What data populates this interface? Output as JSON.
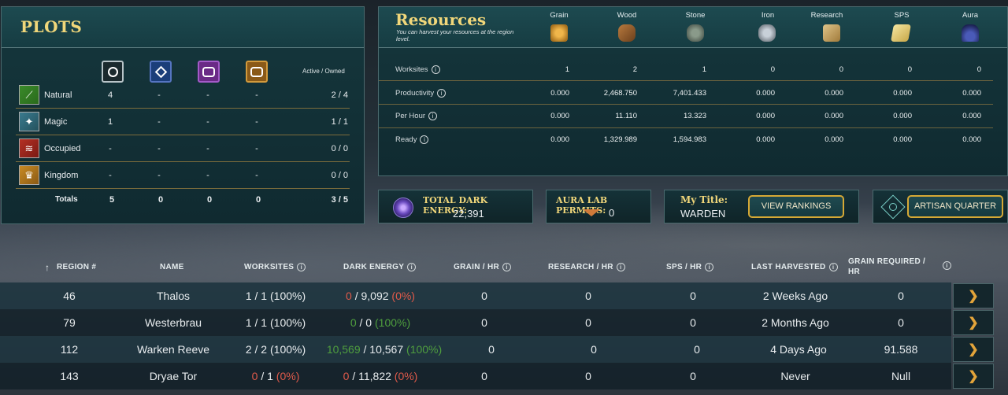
{
  "plots": {
    "title": "PLOTS",
    "active_owned_label": "Active / Owned",
    "rows": [
      {
        "label": "Natural",
        "c1": "4",
        "c2": "-",
        "c3": "-",
        "c4": "-",
        "ratio": "2 / 4"
      },
      {
        "label": "Magic",
        "c1": "1",
        "c2": "-",
        "c3": "-",
        "c4": "-",
        "ratio": "1 / 1"
      },
      {
        "label": "Occupied",
        "c1": "-",
        "c2": "-",
        "c3": "-",
        "c4": "-",
        "ratio": "0 / 0"
      },
      {
        "label": "Kingdom",
        "c1": "-",
        "c2": "-",
        "c3": "-",
        "c4": "-",
        "ratio": "0 / 0"
      }
    ],
    "totals": {
      "label": "Totals",
      "c1": "5",
      "c2": "0",
      "c3": "0",
      "c4": "0",
      "ratio": "3 / 5"
    }
  },
  "resources": {
    "title": "Resources",
    "subtitle": "You can harvest your resources at the region level.",
    "columns": [
      "Grain",
      "Wood",
      "Stone",
      "Iron",
      "Research",
      "SPS",
      "Aura"
    ],
    "rows": [
      {
        "label": "Worksites",
        "values": [
          "1",
          "2",
          "1",
          "0",
          "0",
          "0",
          "0"
        ]
      },
      {
        "label": "Productivity",
        "values": [
          "0.000",
          "2,468.750",
          "7,401.433",
          "0.000",
          "0.000",
          "0.000",
          "0.000"
        ]
      },
      {
        "label": "Per Hour",
        "values": [
          "0.000",
          "11.110",
          "13.323",
          "0.000",
          "0.000",
          "0.000",
          "0.000"
        ]
      },
      {
        "label": "Ready",
        "values": [
          "0.000",
          "1,329.989",
          "1,594.983",
          "0.000",
          "0.000",
          "0.000",
          "0.000"
        ]
      }
    ]
  },
  "status": {
    "dark_energy_label": "TOTAL DARK ENERGY:",
    "dark_energy_value": "22,391",
    "aura_label": "AURA LAB PERMITS:",
    "aura_value": "0",
    "title_label": "My Title:",
    "title_value": "WARDEN",
    "view_rankings": "VIEW RANKINGS",
    "artisan_quarter": "ARTISAN QUARTER"
  },
  "table": {
    "headers": {
      "sort_arrow": "↑",
      "region": "REGION #",
      "name": "NAME",
      "worksites": "WORKSITES",
      "dark_energy": "DARK ENERGY",
      "grain": "GRAIN / HR",
      "research": "RESEARCH / HR",
      "sps": "SPS / HR",
      "last_harvested": "LAST HARVESTED",
      "grain_required_1": "GRAIN REQUIRED /",
      "grain_required_2": "HR"
    },
    "rows": [
      {
        "region": "46",
        "name": "Thalos",
        "ws_a": "1",
        "ws_b": " / 1 ",
        "ws_pct": "(100%)",
        "de_a": "0",
        "de_b": " / 9,092 ",
        "de_pct": "(0%)",
        "grain": "0",
        "research": "0",
        "sps": "0",
        "last": "2 Weeks Ago",
        "req": "0"
      },
      {
        "region": "79",
        "name": "Westerbrau",
        "ws_a": "1",
        "ws_b": " / 1 ",
        "ws_pct": "(100%)",
        "de_a": "0",
        "de_b": " / 0 ",
        "de_pct": "(100%)",
        "grain": "0",
        "research": "0",
        "sps": "0",
        "last": "2 Months Ago",
        "req": "0"
      },
      {
        "region": "112",
        "name": "Warken Reeve",
        "ws_a": "2",
        "ws_b": " / 2 ",
        "ws_pct": "(100%)",
        "de_a": "10,569",
        "de_b": " / 10,567 ",
        "de_pct": "(100%)",
        "grain": "0",
        "research": "0",
        "sps": "0",
        "last": "4 Days Ago",
        "req": "91.588"
      },
      {
        "region": "143",
        "name": "Dryae Tor",
        "ws_a": "0",
        "ws_b": " / 1 ",
        "ws_pct": "(0%)",
        "de_a": "0",
        "de_b": " / 11,822 ",
        "de_pct": "(0%)",
        "grain": "0",
        "research": "0",
        "sps": "0",
        "last": "Never",
        "req": "Null"
      }
    ],
    "arrow_glyph": "❯"
  },
  "colors": {
    "accent_gold": "#d6a935",
    "negative": "#e05a4a",
    "positive": "#4f9e3e"
  }
}
